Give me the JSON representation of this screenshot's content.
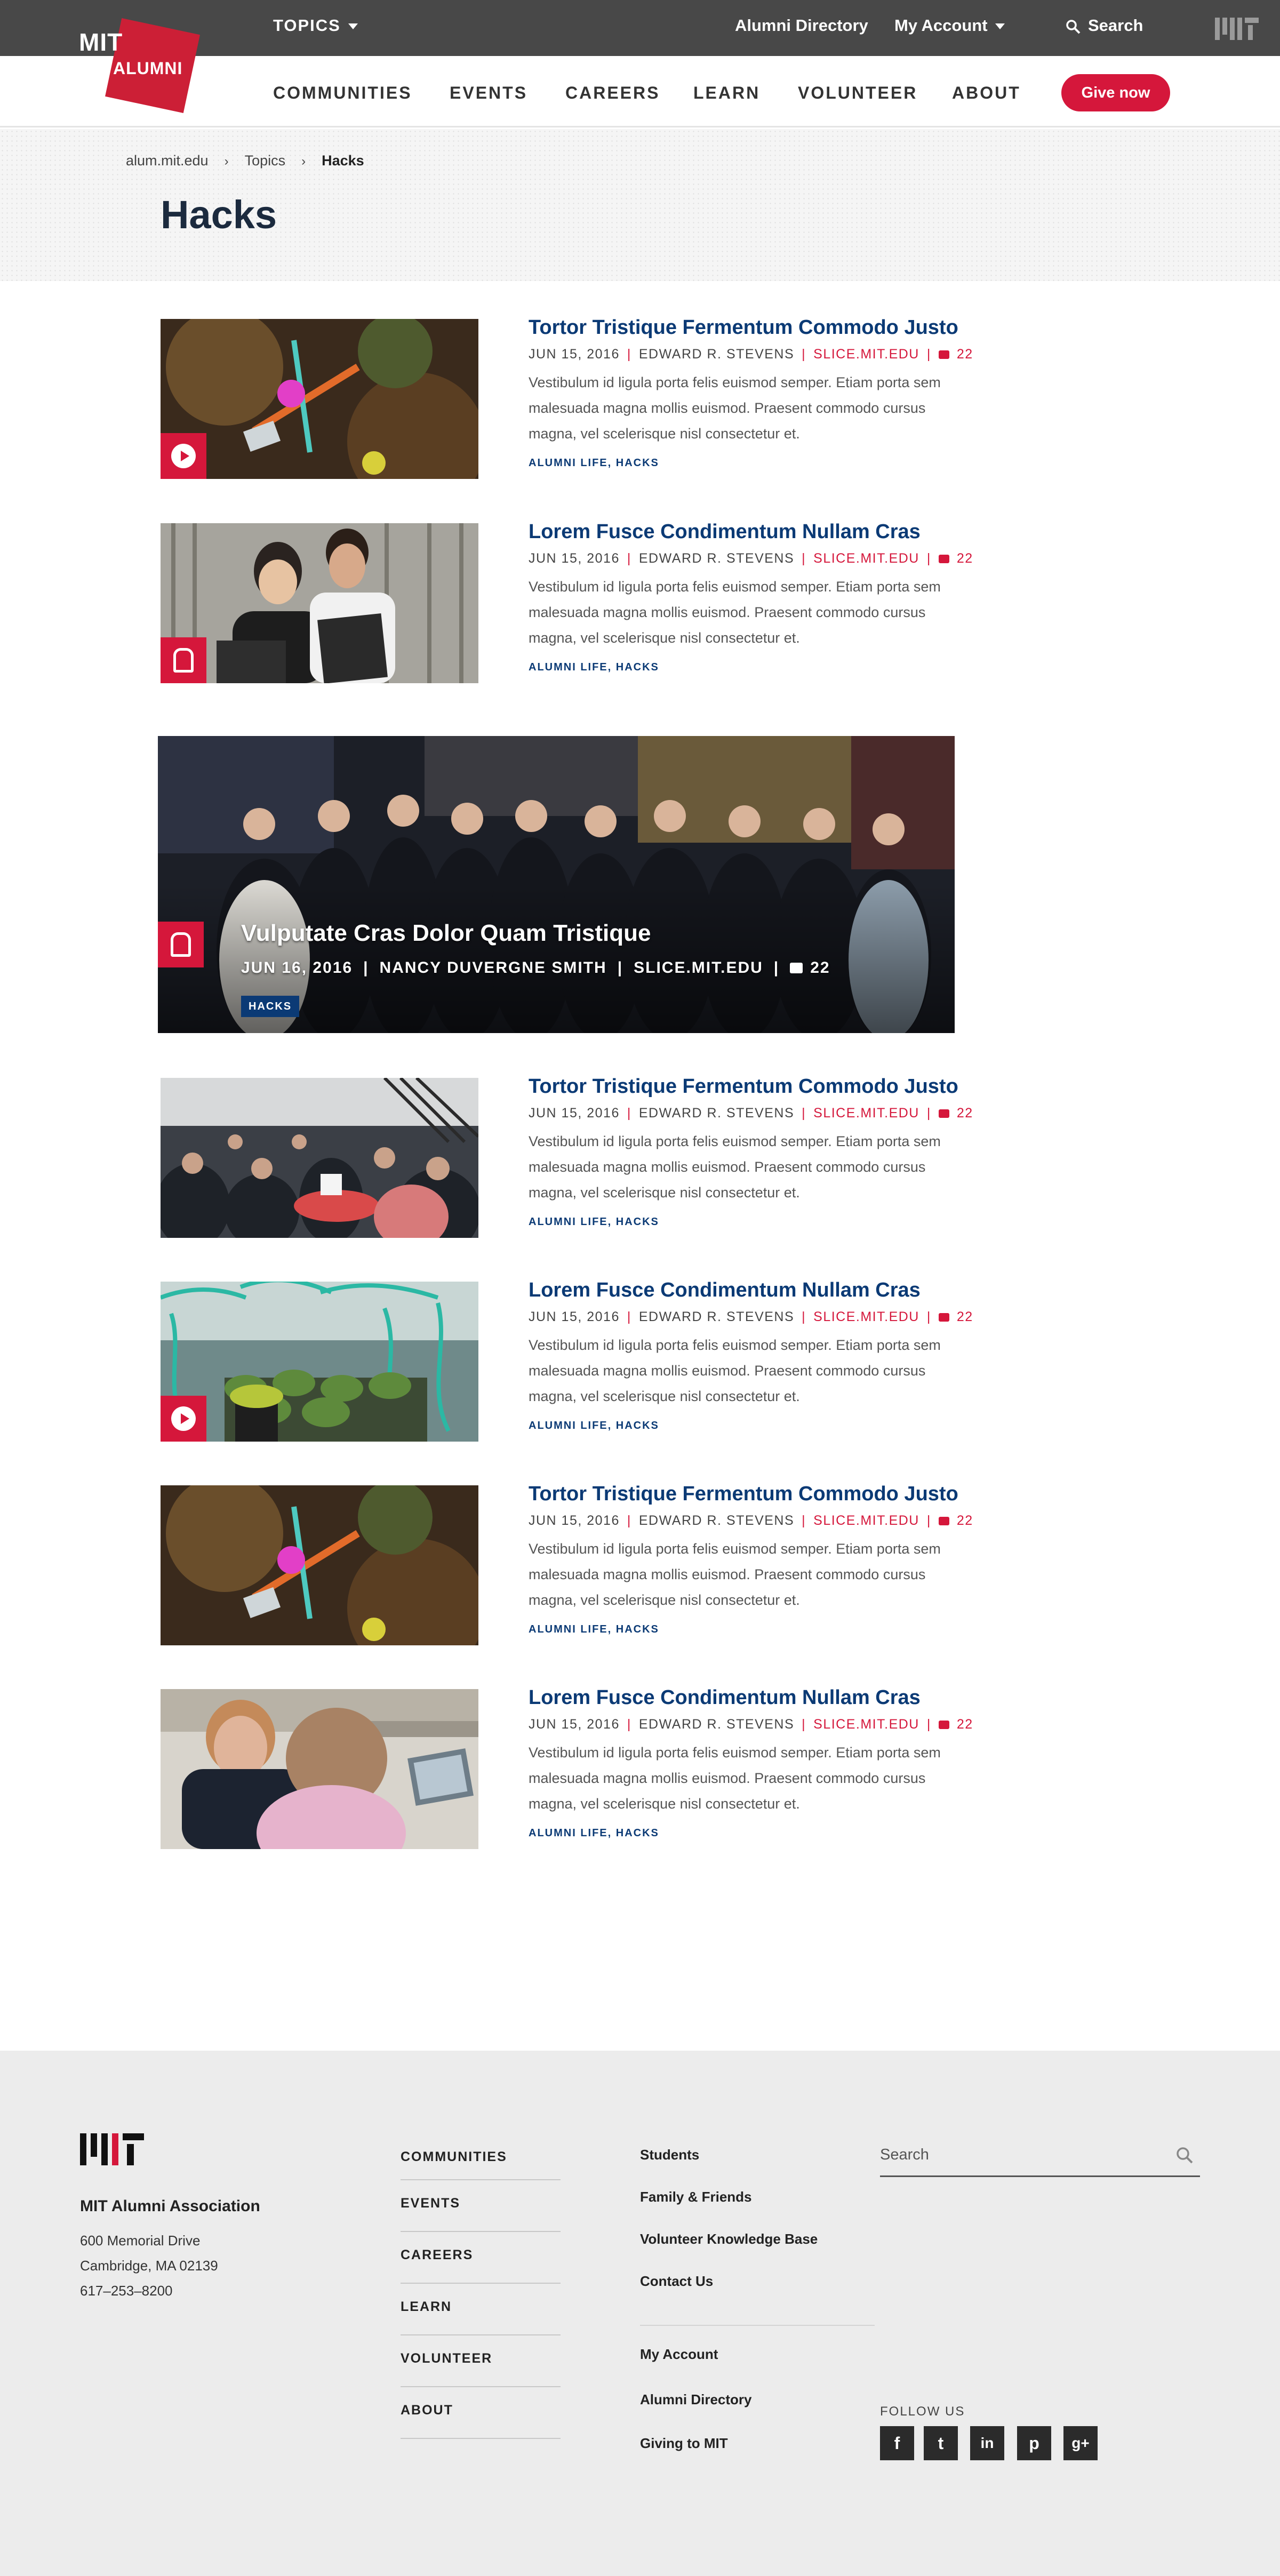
{
  "topbar": {
    "topics": "TOPICS",
    "directory": "Alumni Directory",
    "account": "My Account",
    "search": "Search"
  },
  "logo": {
    "mit": "MIT",
    "alumni": "ALUMNI"
  },
  "nav": {
    "items": [
      "COMMUNITIES",
      "EVENTS",
      "CAREERS",
      "LEARN",
      "VOLUNTEER",
      "ABOUT"
    ],
    "give": "Give now"
  },
  "breadcrumb": {
    "home": "alum.mit.edu",
    "topics": "Topics",
    "current": "Hacks"
  },
  "page_title": "Hacks",
  "articles": [
    {
      "title": "Tortor Tristique Fermentum Commodo Justo",
      "date": "JUN 15, 2016",
      "author": "EDWARD R. STEVENS",
      "source": "SLICE.MIT.EDU",
      "comments": "22",
      "excerpt": "Vestibulum id ligula porta felis euismod semper. Etiam porta sem malesuada magna mollis euismod. Praesent commodo cursus magna, vel scelerisque nisl consectetur et.",
      "tags": "ALUMNI LIFE, HACKS",
      "badge": "play-icon"
    },
    {
      "title": "Lorem Fusce Condimentum Nullam Cras",
      "date": "JUN 15, 2016",
      "author": "EDWARD R. STEVENS",
      "source": "SLICE.MIT.EDU",
      "comments": "22",
      "excerpt": "Vestibulum id ligula porta felis euismod semper. Etiam porta sem malesuada magna mollis euismod. Praesent commodo cursus magna, vel scelerisque nisl consectetur et.",
      "tags": "ALUMNI LIFE, HACKS",
      "badge": "slice-icon"
    },
    {
      "title": "Tortor Tristique Fermentum Commodo Justo",
      "date": "JUN 15, 2016",
      "author": "EDWARD R. STEVENS",
      "source": "SLICE.MIT.EDU",
      "comments": "22",
      "excerpt": "Vestibulum id ligula porta felis euismod semper. Etiam porta sem malesuada magna mollis euismod. Praesent commodo cursus magna, vel scelerisque nisl consectetur et.",
      "tags": "ALUMNI LIFE, HACKS",
      "badge": ""
    },
    {
      "title": "Lorem Fusce Condimentum Nullam Cras",
      "date": "JUN 15, 2016",
      "author": "EDWARD R. STEVENS",
      "source": "SLICE.MIT.EDU",
      "comments": "22",
      "excerpt": "Vestibulum id ligula porta felis euismod semper. Etiam porta sem malesuada magna mollis euismod. Praesent commodo cursus magna, vel scelerisque nisl consectetur et.",
      "tags": "ALUMNI LIFE, HACKS",
      "badge": "play-icon"
    },
    {
      "title": "Tortor Tristique Fermentum Commodo Justo",
      "date": "JUN 15, 2016",
      "author": "EDWARD R. STEVENS",
      "source": "SLICE.MIT.EDU",
      "comments": "22",
      "excerpt": "Vestibulum id ligula porta felis euismod semper. Etiam porta sem malesuada magna mollis euismod. Praesent commodo cursus magna, vel scelerisque nisl consectetur et.",
      "tags": "ALUMNI LIFE, HACKS",
      "badge": ""
    },
    {
      "title": "Lorem Fusce Condimentum Nullam Cras",
      "date": "JUN 15, 2016",
      "author": "EDWARD R. STEVENS",
      "source": "SLICE.MIT.EDU",
      "comments": "22",
      "excerpt": "Vestibulum id ligula porta felis euismod semper. Etiam porta sem malesuada magna mollis euismod. Praesent commodo cursus magna, vel scelerisque nisl consectetur et.",
      "tags": "ALUMNI LIFE, HACKS",
      "badge": ""
    }
  ],
  "featured": {
    "title": "Vulputate Cras Dolor Quam Tristique",
    "date": "JUN 16, 2016",
    "author": "NANCY DUVERGNE SMITH",
    "source": "SLICE.MIT.EDU",
    "comments": "22",
    "tag": "HACKS",
    "badge": "slice-icon"
  },
  "footer": {
    "org": "MIT Alumni Association",
    "address": [
      "600 Memorial Drive",
      "Cambridge, MA 02139",
      "617–253–8200"
    ],
    "col1": [
      "COMMUNITIES",
      "EVENTS",
      "CAREERS",
      "LEARN",
      "VOLUNTEER",
      "ABOUT"
    ],
    "col2a": [
      "Students",
      "Family & Friends",
      "Volunteer Knowledge Base",
      "Contact Us"
    ],
    "col2b": [
      "My Account",
      "Alumni Directory",
      "Giving to MIT"
    ],
    "search_placeholder": "Search",
    "follow": "FOLLOW US",
    "social": [
      "f",
      "t",
      "in",
      "p",
      "g+"
    ]
  },
  "colors": {
    "brand_red": "#d5173b",
    "title_blue": "#0b3a75",
    "topbar": "#484848",
    "footer_bg": "#ececec"
  }
}
